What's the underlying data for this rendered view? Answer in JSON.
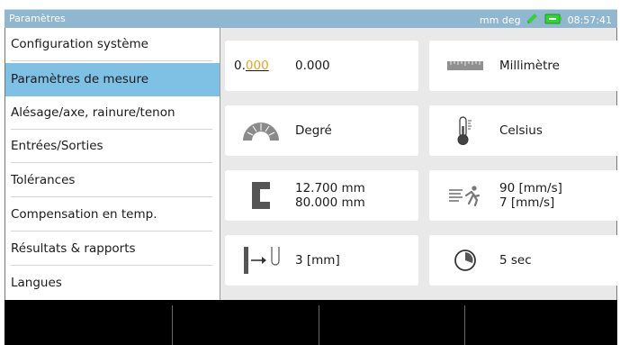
{
  "window": {
    "title": "Paramètres",
    "status": {
      "units": "mm deg",
      "time": "08:57:41",
      "pencil_icon": "pencil-icon",
      "battery_icon": "battery-icon",
      "accent_color": "#30d030"
    }
  },
  "sidebar": {
    "active_index": 1,
    "items": [
      {
        "label": "Configuration système"
      },
      {
        "label": "Paramètres de mesure"
      },
      {
        "label": "Alésage/axe, rainure/tenon"
      },
      {
        "label": "Entrées/Sorties"
      },
      {
        "label": "Tolérances"
      },
      {
        "label": "Compensation en temp."
      },
      {
        "label": "Résultats & rapports"
      },
      {
        "label": "Langues"
      }
    ],
    "active_color": "#7fc1e4"
  },
  "tiles": [
    {
      "icon": "resolution-icon",
      "icon_text_prefix": "0.",
      "icon_text_underlined": "000",
      "line1": "0.000"
    },
    {
      "icon": "ruler-icon",
      "line1": "Millimètre"
    },
    {
      "icon": "protractor-icon",
      "line1": "Degré"
    },
    {
      "icon": "thermometer-icon",
      "line1": "Celsius"
    },
    {
      "icon": "ring-gauge-icon",
      "line1": "12.700 mm",
      "line2": "80.000 mm"
    },
    {
      "icon": "speed-runner-icon",
      "line1": "90 [mm/s]",
      "line2": "7 [mm/s]"
    },
    {
      "icon": "probe-travel-icon",
      "line1": "3 [mm]"
    },
    {
      "icon": "timer-icon",
      "line1": "5 sec"
    }
  ],
  "softkeys": [
    {
      "label": ""
    },
    {
      "label": ""
    },
    {
      "label": ""
    },
    {
      "label": ""
    }
  ]
}
